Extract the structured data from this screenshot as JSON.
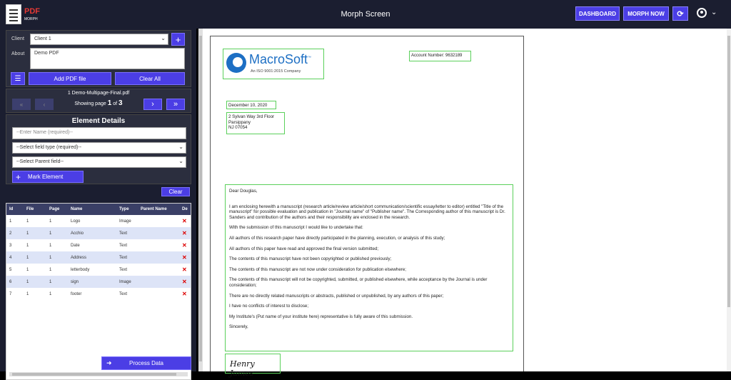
{
  "app": {
    "logo_text": "PDF",
    "logo_sub": "MORPH",
    "title": "Morph Screen"
  },
  "topbar": {
    "dashboard": "DASHBOARD",
    "morph_now": "MORPH NOW"
  },
  "client": {
    "label": "Client",
    "value": "Client 1",
    "about_label": "About",
    "about_value": "Demo PDF"
  },
  "actions": {
    "add_pdf": "Add PDF file",
    "clear_all": "Clear All"
  },
  "file": {
    "name": "1 Demo-Multipage-Final.pdf",
    "showing_label": "Showing page",
    "page": "1",
    "of_label": "of",
    "total": "3"
  },
  "element_details": {
    "title": "Element Details",
    "name_placeholder": "--Enter Name (required)--",
    "field_type": "--Select field type (required)--",
    "parent_field": "--Select Parent field--",
    "mark_button": "Mark Element",
    "clear_button": "Clear"
  },
  "table": {
    "headers": [
      "Id",
      "File",
      "Page",
      "Name",
      "Type",
      "Parent Name",
      "De"
    ],
    "rows": [
      {
        "id": "1",
        "file": "1",
        "page": "1",
        "name": "Logo",
        "type": "Image",
        "parent": ""
      },
      {
        "id": "2",
        "file": "1",
        "page": "1",
        "name": "Acchio",
        "type": "Text",
        "parent": ""
      },
      {
        "id": "3",
        "file": "1",
        "page": "1",
        "name": "Date",
        "type": "Text",
        "parent": ""
      },
      {
        "id": "4",
        "file": "1",
        "page": "1",
        "name": "Address",
        "type": "Text",
        "parent": ""
      },
      {
        "id": "5",
        "file": "1",
        "page": "1",
        "name": "letterbody",
        "type": "Text",
        "parent": ""
      },
      {
        "id": "6",
        "file": "1",
        "page": "1",
        "name": "sign",
        "type": "Image",
        "parent": ""
      },
      {
        "id": "7",
        "file": "1",
        "page": "1",
        "name": "footer",
        "type": "Text",
        "parent": ""
      }
    ]
  },
  "process": {
    "label": "Process Data"
  },
  "doc": {
    "brand": "MacroSoft",
    "brand_tm": "™",
    "iso": "An ISO 9001:2015 Company",
    "account": "Account Number: 9632189",
    "date": "December 10, 2020",
    "address": [
      "2 Sylvan Way 3rd Floor",
      "Parsippany",
      "NJ 07054"
    ],
    "letter": [
      "Dear Douglas,",
      "I am enclosing herewith a manuscript (research article/review article/short communication/scientific essay/letter to editor) entitled \"Title of the manuscript\" for possible evaluation and publication in \"Journal name\" of \"Publisher name\". The Corresponding author of this manuscript is Dr. Sanders and contribution of the authors and their responsibility are enclosed in the research.",
      "With the submission of this manuscript I would like to undertake that:",
      "All authors of this research paper have directly participated in the planning, execution, or analysis of this study;",
      "All authors of this paper have read and approved the final version submitted;",
      "The contents of this manuscript have not been copyrighted or published previously;",
      "The contents of this manuscript are not now under consideration for publication elsewhere;",
      "The contents of this manuscript will not be copyrighted, submitted, or published elsewhere, while acceptance by the Journal is under consideration;",
      "There are no directly related manuscripts or abstracts, published or unpublished, by any authors of this paper;",
      "I have no conflicts of interest to disclose;",
      "My Institute's (Put name of your institute here) representative is fully aware of this submission.",
      "Sincerely,"
    ],
    "signature": "Henry James"
  },
  "colors": {
    "accent": "#4b3ee5",
    "topbar": "#1b1e30",
    "highlight": "#5bd05b",
    "delete": "#dd0000"
  }
}
